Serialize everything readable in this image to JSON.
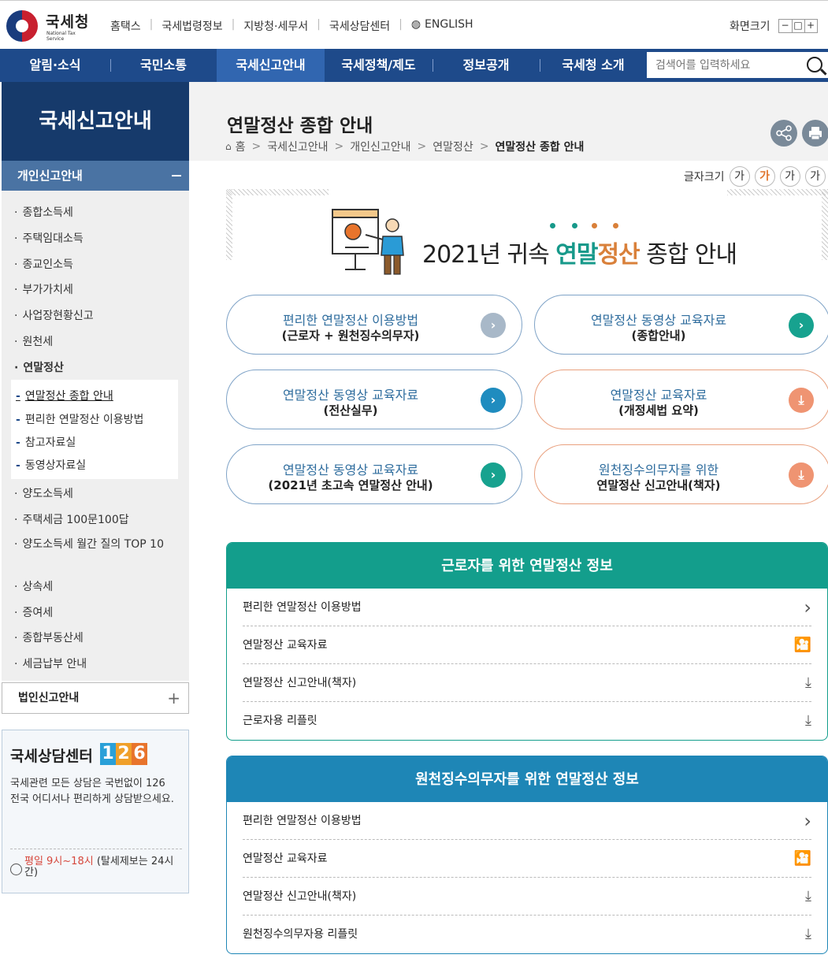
{
  "header": {
    "logo_text": "국세청",
    "logo_sub": "National Tax Service",
    "util_links": [
      "홈택스",
      "국세법령정보",
      "지방청·세무서",
      "국세상담센터",
      "ENGLISH"
    ],
    "screen_size_label": "화면크기",
    "screen_btns": [
      "−",
      "□",
      "+"
    ]
  },
  "nav": {
    "items": [
      "알림·소식",
      "국민소통",
      "국세신고안내",
      "국세정책/제도",
      "정보공개",
      "국세청 소개"
    ],
    "active_index": 2,
    "search_placeholder": "검색어를 입력하세요"
  },
  "sidebar": {
    "title": "국세신고안내",
    "section": "개인신고안내",
    "items": [
      "종합소득세",
      "주택임대소득",
      "종교인소득",
      "부가가치세",
      "사업장현황신고",
      "원천세",
      "연말정산",
      "양도소득세",
      "주택세금 100문100답",
      "양도소득세 월간 질의 TOP 10",
      "상속세",
      "증여세",
      "종합부동산세",
      "세금납부 안내"
    ],
    "sub_items": [
      "연말정산 종합 안내",
      "편리한 연말정산 이용방법",
      "참고자료실",
      "동영상자료실"
    ],
    "corp": "법인신고안내",
    "counsel": {
      "title": "국세상담센터",
      "number": [
        "1",
        "2",
        "6"
      ],
      "desc": "국세관련 모든 상담은 국번없이 126 전국 어디서나 편리하게 상담받으세요.",
      "hours_red": "평일 9시~18시",
      "hours_rest": "(탈세제보는 24시간)"
    }
  },
  "content": {
    "title": "연말정산 종합 안내",
    "breadcrumb": [
      "홈",
      "국세신고안내",
      "개인신고안내",
      "연말정산",
      "연말정산 종합 안내"
    ],
    "font_size_label": "글자크기",
    "font_size_btns": [
      "가",
      "가",
      "가",
      "가"
    ],
    "banner": {
      "pre": "2021년 귀속 ",
      "green": "연말",
      "orange": "정산",
      "post": " 종합 안내"
    },
    "pills": [
      {
        "l1": "편리한 연말정산 이용방법",
        "l2": "(근로자 + 원천징수의무자)",
        "icon": "chevron-right-icon",
        "color": "#a8b8c8"
      },
      {
        "l1": "연말정산 동영상 교육자료",
        "l2": "(종합안내)",
        "icon": "chevron-right-icon",
        "color": "#17a28f"
      },
      {
        "l1": "연말정산 동영상 교육자료",
        "l2": "(전산실무)",
        "icon": "chevron-right-icon",
        "color": "#1f8cbf"
      },
      {
        "l1": "연말정산 교육자료",
        "l2": "(개정세법 요약)",
        "icon": "download-icon",
        "color": "#ef9472"
      },
      {
        "l1": "연말정산 동영상 교육자료",
        "l2": "(2021년 초고속 연말정산 안내)",
        "icon": "chevron-right-icon",
        "color": "#17a28f"
      },
      {
        "l1": "원천징수의무자를 위한",
        "l2": "연말정산 신고안내(책자)",
        "icon": "download-icon",
        "color": "#ef9472"
      }
    ],
    "sections": [
      {
        "title": "근로자를 위한 연말정산 정보",
        "color": "#139e8c",
        "rows": [
          "편리한 연말정산 이용방법",
          "연말정산 교육자료",
          "연말정산 신고안내(책자)",
          "근로자용 리플릿"
        ]
      },
      {
        "title": "원천징수의무자를 위한 연말정산 정보",
        "color": "#1e86b6",
        "rows": [
          "편리한 연말정산 이용방법",
          "연말정산 교육자료",
          "연말정산 신고안내(책자)",
          "원천징수의무자용 리플릿"
        ]
      }
    ],
    "row_icons": [
      "chevron-right-icon",
      "video-icon",
      "download-icon",
      "download-icon"
    ]
  }
}
